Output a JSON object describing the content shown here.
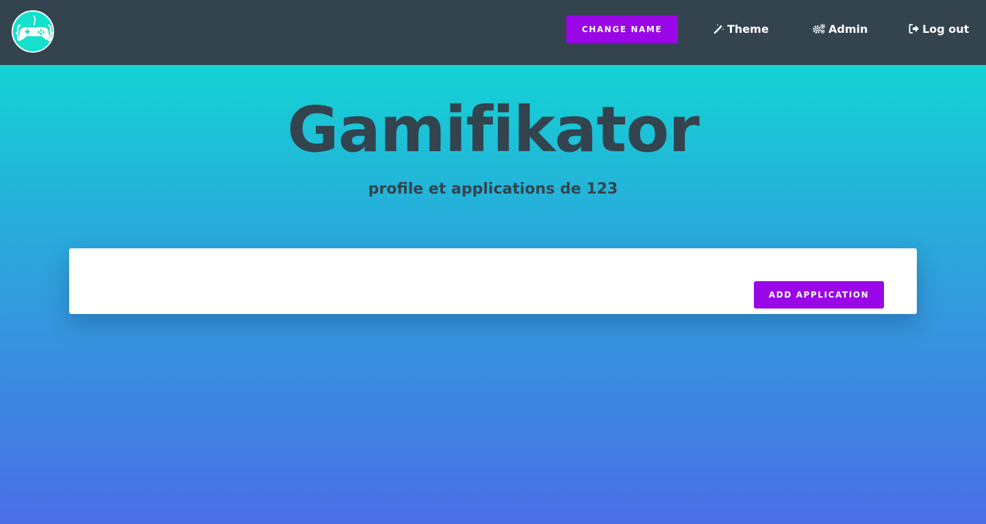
{
  "navbar": {
    "logo_icon": "gamepad-logo-icon",
    "change_name_label": "CHANGE NAME",
    "links": [
      {
        "label": "Theme",
        "icon": "magic-wand-icon"
      },
      {
        "label": "Admin",
        "icon": "gears-icon"
      },
      {
        "label": "Log out",
        "icon": "sign-out-icon"
      }
    ]
  },
  "hero": {
    "title": "Gamifikator",
    "subtitle": "profile et applications de 123"
  },
  "card": {
    "add_application_label": "ADD APPLICATION"
  },
  "colors": {
    "navbar_bg": "#34444f",
    "accent_button": "#9a07e6",
    "logo_bg": "#14e0cc",
    "gradient_top": "#0be4d2",
    "gradient_bottom": "#4a6ee6",
    "heading_text": "#33444e"
  }
}
